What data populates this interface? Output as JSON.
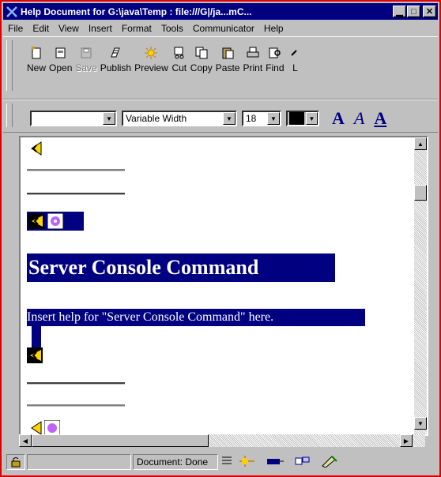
{
  "window": {
    "title": "Help Document for G:\\java\\Temp : file:///G|/ja...mC...",
    "buttons": {
      "minimize": "▁",
      "maximize": "□",
      "close": "✕"
    }
  },
  "menubar": [
    "File",
    "Edit",
    "View",
    "Insert",
    "Format",
    "Tools",
    "Communicator",
    "Help"
  ],
  "toolbar": [
    {
      "label": "New",
      "icon": "new-icon"
    },
    {
      "label": "Open",
      "icon": "open-icon"
    },
    {
      "label": "Save",
      "icon": "save-icon",
      "disabled": true
    },
    {
      "label": "Publish",
      "icon": "publish-icon"
    },
    {
      "label": "Preview",
      "icon": "preview-icon"
    },
    {
      "label": "Cut",
      "icon": "cut-icon"
    },
    {
      "label": "Copy",
      "icon": "copy-icon"
    },
    {
      "label": "Paste",
      "icon": "paste-icon"
    },
    {
      "label": "Print",
      "icon": "print-icon"
    },
    {
      "label": "Find",
      "icon": "find-icon"
    },
    {
      "label": "L",
      "icon": "link-icon"
    }
  ],
  "format": {
    "paragraph_style": "",
    "font": "Variable Width",
    "size": "18",
    "color": "#000000",
    "letters": [
      "A",
      "A",
      "A"
    ]
  },
  "document": {
    "heading": "Server Console Command",
    "paragraph": "Insert help for \"Server Console Command\" here."
  },
  "status": {
    "text": "Document: Done"
  }
}
